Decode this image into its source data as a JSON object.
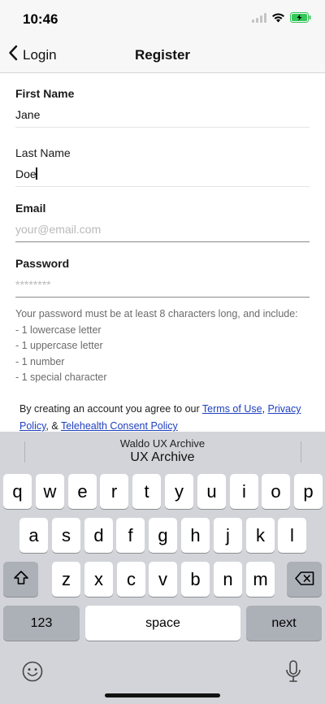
{
  "status_bar": {
    "time": "10:46"
  },
  "nav": {
    "back_label": "Login",
    "title": "Register"
  },
  "form": {
    "first_name": {
      "label": "First Name",
      "value": "Jane"
    },
    "last_name": {
      "label": "Last Name",
      "value": "Doe"
    },
    "email": {
      "label": "Email",
      "placeholder": "your@email.com"
    },
    "password": {
      "label": "Password",
      "placeholder": "********"
    }
  },
  "password_rules": {
    "intro": "Your password must be at least 8 characters long, and include:",
    "items": [
      "- 1 lowercase letter",
      "- 1 uppercase letter",
      "- 1 number",
      "- 1 special character"
    ]
  },
  "legal": {
    "prefix": "By creating an account you agree to our ",
    "terms": "Terms of Use",
    "sep1": ", ",
    "privacy": "Privacy Policy",
    "sep2": ", & ",
    "telehealth": "Telehealth Consent Policy"
  },
  "keyboard": {
    "suggestion_top": "Waldo UX Archive",
    "suggestion_main": "UX Archive",
    "row1": [
      "q",
      "w",
      "e",
      "r",
      "t",
      "y",
      "u",
      "i",
      "o",
      "p"
    ],
    "row2": [
      "a",
      "s",
      "d",
      "f",
      "g",
      "h",
      "j",
      "k",
      "l"
    ],
    "row3": [
      "z",
      "x",
      "c",
      "v",
      "b",
      "n",
      "m"
    ],
    "numbers_label": "123",
    "space_label": "space",
    "next_label": "next"
  },
  "icons": {
    "back": "chevron-left-icon",
    "wifi": "wifi-icon",
    "battery": "battery-charging-icon",
    "signal": "signal-icon",
    "shift": "shift-icon",
    "delete": "backspace-icon",
    "emoji": "emoji-icon",
    "mic": "microphone-icon"
  },
  "colors": {
    "link": "#1d3fbf",
    "battery": "#34c759",
    "keyboard_bg": "#d2d4d9"
  }
}
